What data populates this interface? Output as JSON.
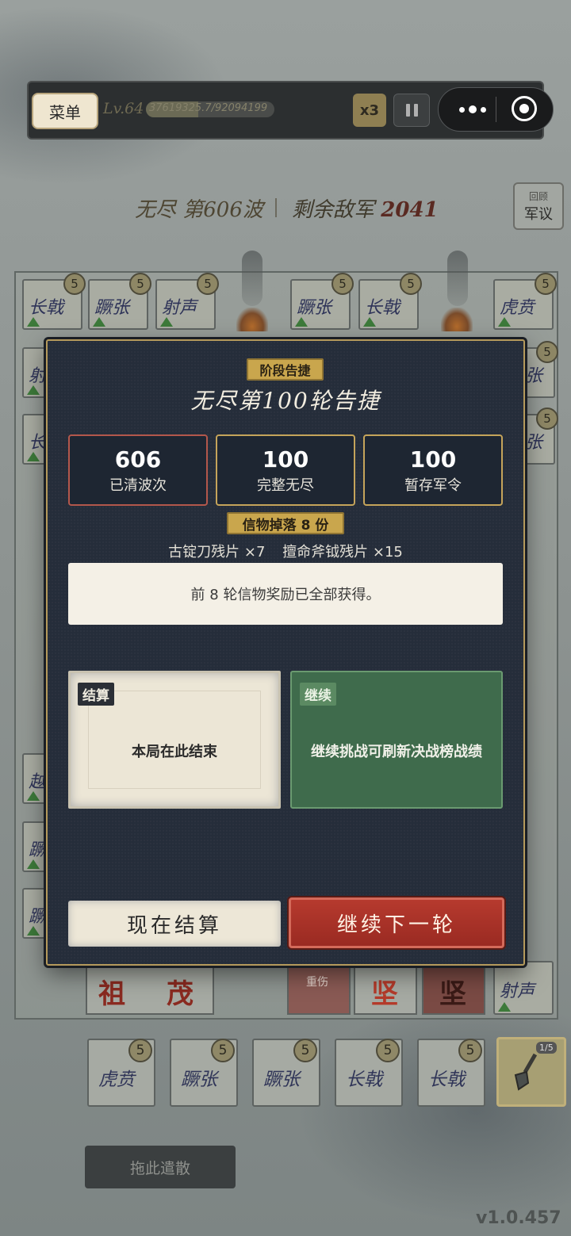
{
  "topbar": {
    "menu_label": "菜单",
    "level_text": "Lv.64",
    "xp_text": "37619325.7/92094199",
    "xp_progress": 0.41,
    "speed_label": "x3"
  },
  "wave": {
    "wave_text": "无尽 第606波",
    "enemy_label": "剩余敌军",
    "enemy_count": "2041"
  },
  "review": {
    "small_label": "回顾",
    "label": "军议"
  },
  "board": {
    "top_row": [
      {
        "name": "长戟",
        "level": "5"
      },
      {
        "name": "蹶张",
        "level": "5"
      },
      {
        "name": "射声",
        "level": "5"
      },
      {
        "name": "蹶张",
        "level": "5"
      },
      {
        "name": "长戟",
        "level": "5"
      },
      {
        "name": "虎贲",
        "level": "5"
      }
    ],
    "left_col": [
      {
        "name": "射"
      },
      {
        "name": "长"
      },
      {
        "name": "越"
      },
      {
        "name": "蹶"
      },
      {
        "name": "蹶"
      }
    ],
    "right_levels": [
      "5",
      "5"
    ],
    "right_col": [
      {
        "name": "张"
      },
      {
        "name": "张"
      }
    ],
    "lower": {
      "zu_name": "祖",
      "mao_name": "茂",
      "injury_label": "重伤",
      "jian_name": "坚",
      "jian2_name": "坚",
      "shesheng_name": "射声"
    }
  },
  "hand": [
    {
      "name": "虎贲",
      "level": "5"
    },
    {
      "name": "蹶张",
      "level": "5"
    },
    {
      "name": "蹶张",
      "level": "5"
    },
    {
      "name": "长戟",
      "level": "5"
    },
    {
      "name": "长戟",
      "level": "5"
    }
  ],
  "shovel": {
    "count": "1/5"
  },
  "discard_label": "拖此遣散",
  "version": "v1.0.457",
  "modal": {
    "stage_badge": "阶段告捷",
    "title": "无尽第100轮告捷",
    "stats": [
      {
        "value": "606",
        "label": "已清波次"
      },
      {
        "value": "100",
        "label": "完整无尽"
      },
      {
        "value": "100",
        "label": "暂存军令"
      }
    ],
    "drop_badge": "信物掉落 8 份",
    "drop_items": [
      "古锭刀残片 ×7",
      "擅命斧钺残片 ×15"
    ],
    "notice": "前 8 轮信物奖励已全部获得。",
    "settle_choice": {
      "tag": "结算",
      "text": "本局在此结束"
    },
    "continue_choice": {
      "tag": "继续",
      "text": "继续挑战可刷新决战榜战绩"
    },
    "settle_button": "现在结算",
    "next_button": "继续下一轮"
  },
  "colors": {
    "modal_bg": "#252d3a",
    "gold": "#c9a64d",
    "red_button": "#b63a2e",
    "green_choice": "#3f6b4c"
  }
}
